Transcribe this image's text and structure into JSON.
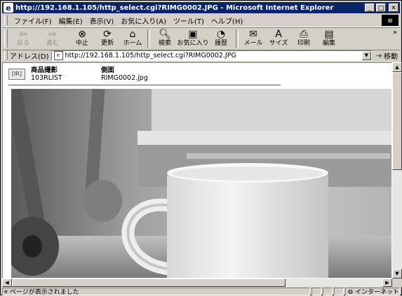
{
  "window": {
    "title": "http://192.168.1.105/http_select.cgi?RIMG0002.JPG - Microsoft Internet Explorer",
    "controls": {
      "minimize": "_",
      "maximize": "□",
      "close": "✕"
    }
  },
  "menu": {
    "items": [
      "ファイル(F)",
      "編集(E)",
      "表示(V)",
      "お気に入り(A)",
      "ツール(T)",
      "ヘルプ(H)"
    ]
  },
  "toolbar": {
    "back": "戻る",
    "forward": "進む",
    "stop": "中止",
    "refresh": "更新",
    "home": "ホーム",
    "search": "検索",
    "favorites": "お気に入り",
    "history": "履歴",
    "mail": "メール",
    "size": "サイズ",
    "print": "印刷",
    "edit": "編集",
    "more": "»"
  },
  "address": {
    "label": "アドレス(D)",
    "url": "http://192.168.1.105/http_select.cgi?RIMG0002.JPG",
    "go": "移動"
  },
  "page": {
    "icon_text": "[IR]",
    "col1_title": "商品撮影",
    "col1_value": "103RLIST",
    "col2_title": "側面",
    "col2_value": "RIMG0002.jpg"
  },
  "status": {
    "text": "ページが表示されました",
    "zone": "インターネット"
  },
  "icons": {
    "status_page": "page-icon",
    "zone": "globe-icon"
  }
}
